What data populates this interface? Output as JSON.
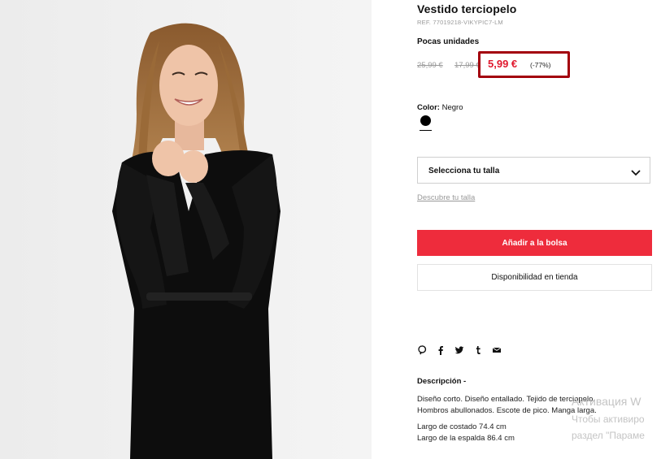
{
  "product": {
    "title": "Vestido terciopelo",
    "ref": "REF. 77019218-VIKYPIC7-LM",
    "stock_label": "Pocas unidades",
    "original_price": "25,99 €",
    "previous_price": "17,99 €",
    "current_price": "5,99 €",
    "discount": "(-77%)",
    "color_label": "Color:",
    "color_value": "Negro",
    "size_select_label": "Selecciona tu talla",
    "size_guide_link": "Descubre tu talla",
    "add_to_bag": "Añadir a la bolsa",
    "store_availability": "Disponibilidad en tienda"
  },
  "share_icons": [
    "pinterest-icon",
    "facebook-icon",
    "twitter-icon",
    "tumblr-icon",
    "email-icon"
  ],
  "description": {
    "title": "Descripción -",
    "line1": "Diseño corto. Diseño entallado. Tejido de terciopelo.",
    "line2": "Hombros abullonados. Escote de pico. Manga larga.",
    "line3": "Largo de costado 74.4 cm",
    "line4": "Largo de la espalda 86.4 cm"
  },
  "watermark": {
    "line1": "Активация W",
    "line2": "Чтобы активиро",
    "line3": "раздел \"Параме"
  },
  "colors": {
    "accent": "#ee2c3c",
    "price": "#e0182d",
    "highlight_box": "#a3000d"
  }
}
